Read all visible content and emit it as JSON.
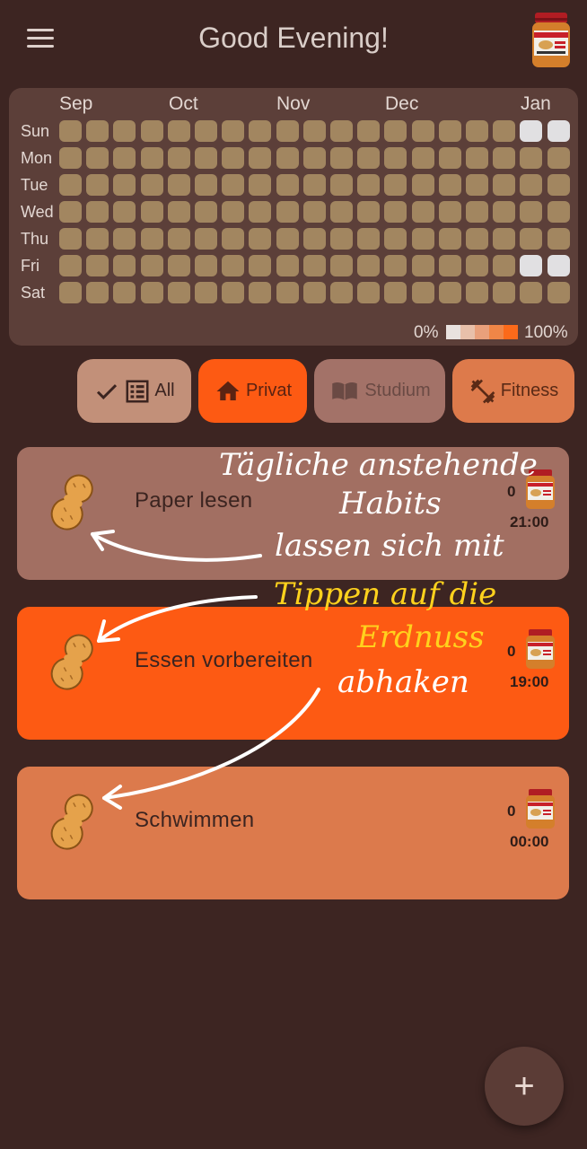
{
  "header": {
    "title": "Good Evening!"
  },
  "heatmap": {
    "months": [
      "Sep",
      "Oct",
      "Nov",
      "Dec",
      "Jan"
    ],
    "days": [
      "Sun",
      "Mon",
      "Tue",
      "Wed",
      "Thu",
      "Fri",
      "Sat"
    ],
    "weeks": 19,
    "legend_low": "0%",
    "legend_high": "100%",
    "legend_colors": [
      "#e9e2df",
      "#e8c0aa",
      "#e9a07b",
      "#ef8647",
      "#fb6a1a"
    ],
    "cell_color": "#a28660",
    "today_color": "#e1e0e2"
  },
  "filters": [
    {
      "label": "All",
      "selected": true
    },
    {
      "label": "Privat",
      "selected": false
    },
    {
      "label": "Studium",
      "selected": false
    },
    {
      "label": "Fitness",
      "selected": false
    }
  ],
  "habits": [
    {
      "name": "Paper lesen",
      "count": "0",
      "time": "21:00",
      "color": "#a26f62"
    },
    {
      "name": "Essen vorbereiten",
      "count": "0",
      "time": "19:00",
      "color": "#fd5a13"
    },
    {
      "name": "Schwimmen",
      "count": "0",
      "time": "00:00",
      "color": "#dc7a4c"
    }
  ],
  "annotation": {
    "line1": "Tägliche anstehende",
    "line2": "Habits",
    "line3": "lassen sich mit",
    "line4": "Tippen auf die",
    "line5": "Erdnuss",
    "line6": "abhaken"
  },
  "fab": {
    "label": "+"
  }
}
